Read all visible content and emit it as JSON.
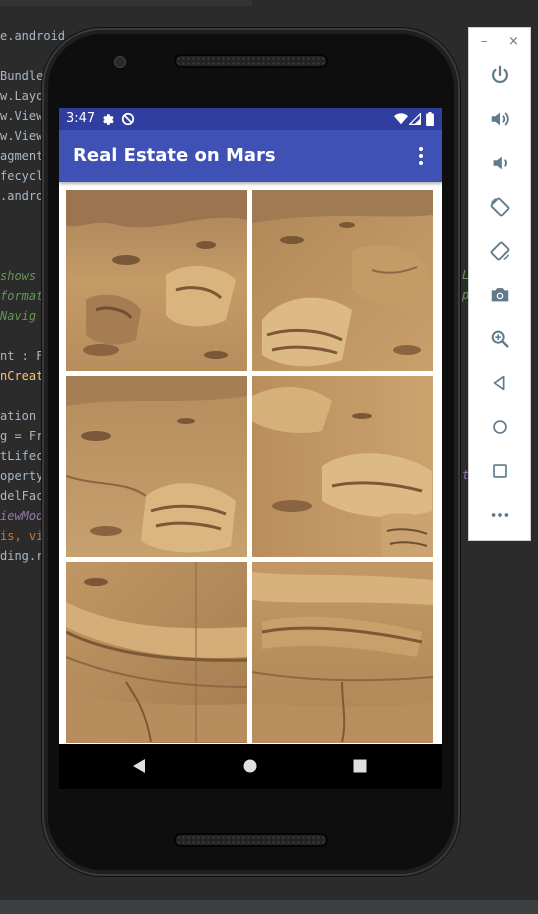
{
  "ide": {
    "code_fragments": [
      "e.android",
      "Bundle",
      "w.Layo",
      "w.View",
      "w.View",
      "agment",
      "fecycl",
      ".andro",
      "shows",
      "format",
      "Navig",
      "nt : F",
      "nCreat",
      "ation",
      "g = Fr",
      "tLifec",
      "operty",
      "delFac",
      "iewMode",
      "is, vi",
      "ding.r"
    ],
    "right_fragments": [
      "L",
      "p",
      "t"
    ]
  },
  "tool_panel": {
    "minimize_label": "–",
    "close_label": "×",
    "buttons": [
      {
        "name": "power",
        "icon": "power-icon"
      },
      {
        "name": "volume-up",
        "icon": "volume-up-icon"
      },
      {
        "name": "volume-down",
        "icon": "volume-down-icon"
      },
      {
        "name": "rotate-left",
        "icon": "rotate-left-icon"
      },
      {
        "name": "rotate-right",
        "icon": "rotate-right-icon"
      },
      {
        "name": "screenshot",
        "icon": "camera-icon"
      },
      {
        "name": "zoom",
        "icon": "zoom-icon"
      },
      {
        "name": "back",
        "icon": "back-icon"
      },
      {
        "name": "home",
        "icon": "home-icon"
      },
      {
        "name": "overview",
        "icon": "overview-icon"
      },
      {
        "name": "more",
        "icon": "more-icon"
      }
    ]
  },
  "status_bar": {
    "time": "3:47",
    "left_icons": [
      "gear-icon",
      "sync-off-icon"
    ],
    "right_icons": [
      "wifi-icon",
      "signal-icon",
      "battery-icon"
    ]
  },
  "app_bar": {
    "title": "Real Estate on Mars",
    "menu_icon": "overflow-menu-icon"
  },
  "grid": {
    "tiles": [
      {
        "name": "mars-photo-1"
      },
      {
        "name": "mars-photo-2"
      },
      {
        "name": "mars-photo-3"
      },
      {
        "name": "mars-photo-4"
      },
      {
        "name": "mars-photo-5"
      },
      {
        "name": "mars-photo-6"
      }
    ]
  },
  "nav_bar": {
    "buttons": [
      "back-icon",
      "home-icon",
      "recents-icon"
    ]
  },
  "colors": {
    "primary": "#3f51b5",
    "primary_dark": "#303f9f",
    "mars_sand": "#c49a66"
  }
}
